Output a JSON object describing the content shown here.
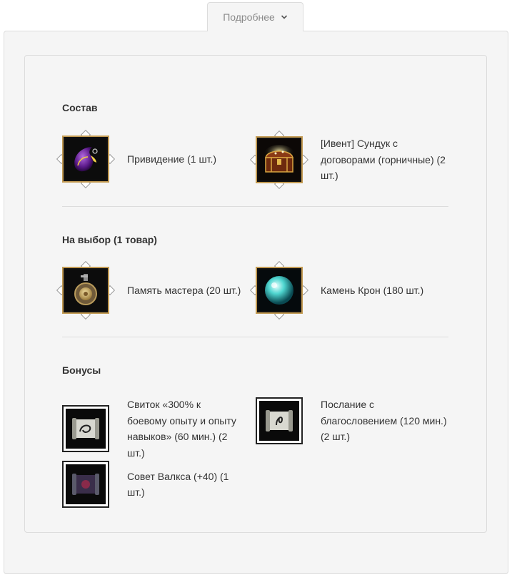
{
  "toggle": {
    "label": "Подробнее",
    "icon": "chevron-down-icon"
  },
  "sections": {
    "composition": {
      "title": "Состав",
      "items": [
        {
          "label": "Привидение (1 шт.)",
          "icon": "ghost-icon"
        },
        {
          "label": "[Ивент] Сундук с договорами (горничные) (2 шт.)",
          "icon": "treasure-chest-icon"
        }
      ]
    },
    "choice": {
      "title": "На выбор (1 товар)",
      "items": [
        {
          "label": "Память мастера (20 шт.)",
          "icon": "amulet-icon"
        },
        {
          "label": "Камень Крон (180 шт.)",
          "icon": "orb-icon"
        }
      ]
    },
    "bonuses": {
      "title": "Бонусы",
      "items": [
        {
          "label": "Свиток «300% к боевому опыту и опыту навыков» (60 мин.) (2 шт.)",
          "icon": "scroll-icon"
        },
        {
          "label": "Послание с благословением (120 мин.) (2 шт.)",
          "icon": "scroll-icon"
        },
        {
          "label": "Совет Валкса (+40) (1 шт.)",
          "icon": "dark-scroll-icon"
        }
      ]
    }
  },
  "colors": {
    "frame_gold": "#c29a52",
    "panel_bg": "#f5f5f5",
    "border": "#dcdcdc"
  }
}
